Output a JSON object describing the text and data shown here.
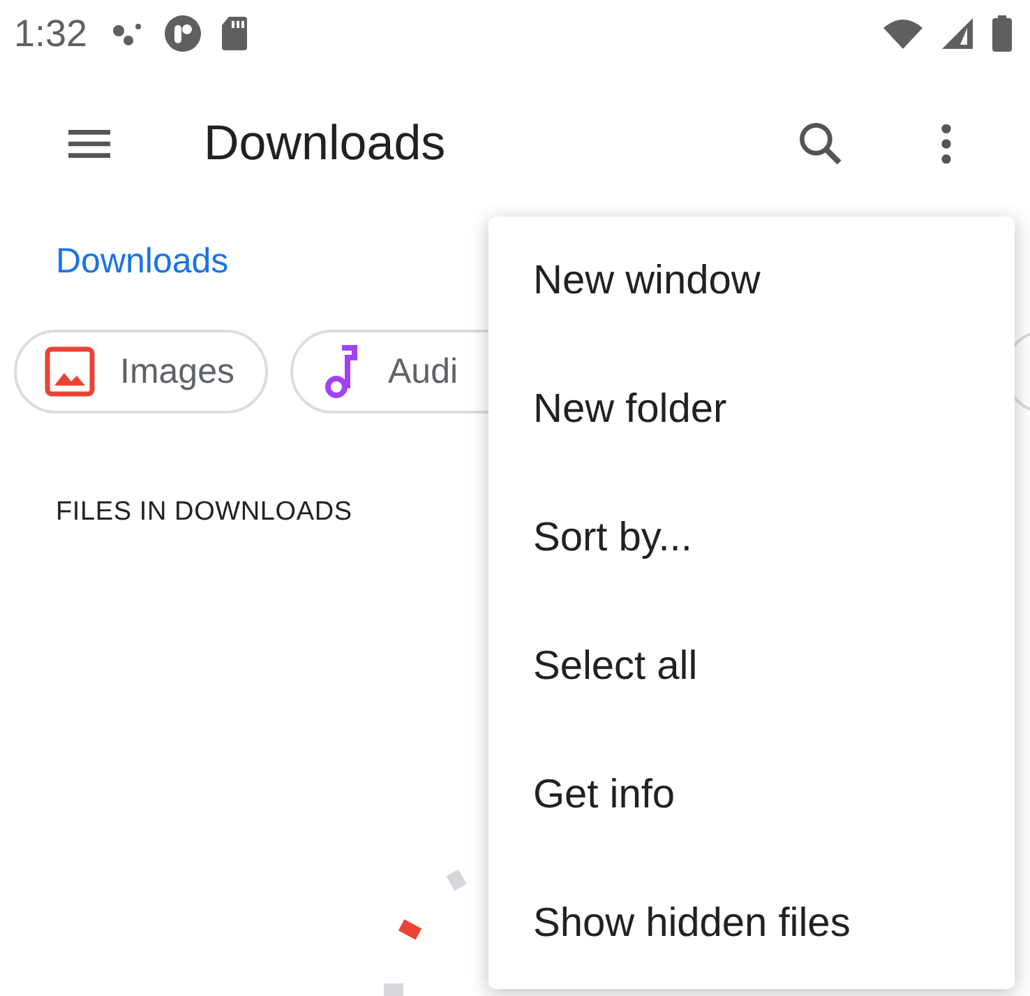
{
  "status_bar": {
    "time": "1:32"
  },
  "toolbar": {
    "title": "Downloads"
  },
  "breadcrumb": "Downloads",
  "chips": [
    {
      "label": "Images",
      "kind": "images"
    },
    {
      "label": "Audi",
      "kind": "audio"
    },
    {
      "kind": "other"
    }
  ],
  "section_header": "FILES IN DOWNLOADS",
  "menu": {
    "items": [
      "New window",
      "New folder",
      "Sort by...",
      "Select all",
      "Get info",
      "Show hidden files"
    ]
  }
}
